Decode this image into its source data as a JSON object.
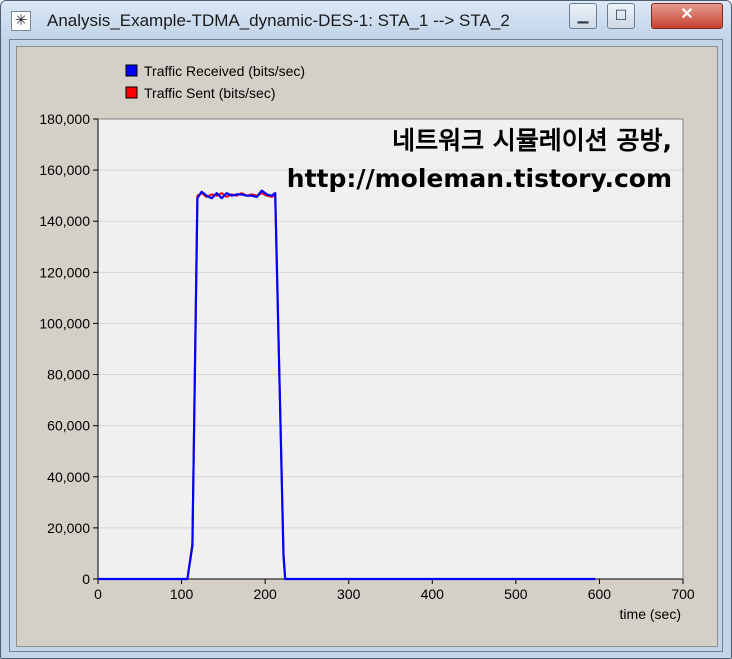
{
  "window": {
    "title": "Analysis_Example-TDMA_dynamic-DES-1: STA_1 --> STA_2",
    "app_icon": "asterisk-icon",
    "minimize_glyph": "▁",
    "maximize_glyph": "☐",
    "close_glyph": "✕"
  },
  "watermark": {
    "line1": "네트워크 시뮬레이션 공방,",
    "line2": "http://moleman.tistory.com"
  },
  "colors": {
    "received": "#0000ff",
    "sent": "#ff0000",
    "plot_bg": "#f0f0f0",
    "panel_bg": "#d4d0c8",
    "grid": "#d6d6d6"
  },
  "chart_data": {
    "type": "line",
    "xlabel": "time (sec)",
    "ylabel": "",
    "title": "",
    "xlim": [
      0,
      700
    ],
    "ylim": [
      0,
      180000
    ],
    "x_ticks": [
      0,
      100,
      200,
      300,
      400,
      500,
      600,
      700
    ],
    "x_tick_labels": [
      "0",
      "100",
      "200",
      "300",
      "400",
      "500",
      "600",
      "700"
    ],
    "y_ticks": [
      0,
      20000,
      40000,
      60000,
      80000,
      100000,
      120000,
      140000,
      160000,
      180000
    ],
    "y_tick_labels": [
      "0",
      "20,000",
      "40,000",
      "60,000",
      "80,000",
      "100,000",
      "120,000",
      "140,000",
      "160,000",
      "180,000"
    ],
    "grid": "horizontal",
    "legend_position": "top-left",
    "series": [
      {
        "name": "Traffic Sent (bits/sec)",
        "color": "#ff0000",
        "x": [
          0,
          107,
          113,
          119,
          124,
          130,
          136,
          142,
          148,
          154,
          160,
          166,
          172,
          178,
          184,
          190,
          196,
          202,
          208,
          212,
          222,
          224,
          230,
          595
        ],
        "y": [
          0,
          0,
          14000,
          150000,
          151000,
          149500,
          150500,
          150000,
          151000,
          149500,
          150500,
          150000,
          151000,
          150000,
          150500,
          150000,
          151000,
          150000,
          149500,
          150500,
          10000,
          0,
          0,
          0
        ]
      },
      {
        "name": "Traffic Received (bits/sec)",
        "color": "#0000ff",
        "x": [
          0,
          107,
          113,
          119,
          124,
          130,
          136,
          142,
          148,
          154,
          160,
          166,
          172,
          178,
          184,
          190,
          196,
          202,
          208,
          212,
          222,
          224,
          230,
          595
        ],
        "y": [
          0,
          0,
          13000,
          149000,
          151500,
          150000,
          149000,
          151000,
          149000,
          151000,
          150000,
          150500,
          150500,
          150000,
          150000,
          149500,
          152000,
          150500,
          150000,
          151000,
          9000,
          0,
          0,
          0
        ]
      }
    ]
  }
}
